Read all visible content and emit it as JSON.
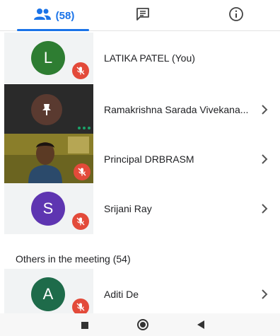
{
  "tabs": {
    "people_count": "(58)"
  },
  "participants": [
    {
      "initial": "L",
      "name": "LATIKA PATEL (You)",
      "avatar_color": "#2e7d32",
      "muted": true,
      "chevron": false
    },
    {
      "initial": "",
      "name": "Ramakrishna Sarada Vivekana...",
      "avatar_color": "#3a3a3a",
      "muted": false,
      "chevron": true
    },
    {
      "initial": "",
      "name": "Principal DRBRASM",
      "avatar_color": "",
      "muted": true,
      "chevron": true
    },
    {
      "initial": "S",
      "name": "Srijani Ray",
      "avatar_color": "#5e35b1",
      "muted": true,
      "chevron": true
    }
  ],
  "others": {
    "title": "Others in the meeting (54)",
    "items": [
      {
        "initial": "A",
        "name": "Aditi De",
        "avatar_color": "#1e6b4a",
        "muted": true,
        "chevron": true
      }
    ]
  },
  "colors": {
    "accent": "#1a73e8",
    "mute_red": "#e34a3a"
  }
}
